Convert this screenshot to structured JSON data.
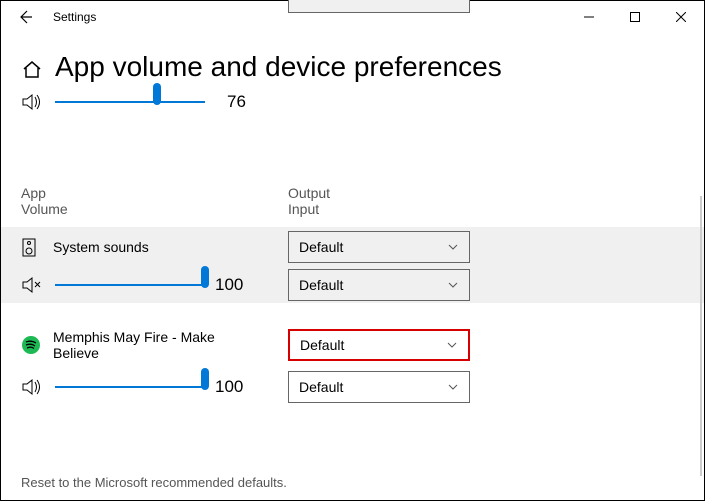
{
  "title": "Settings",
  "heading": "App volume and device preferences",
  "master_volume": 76,
  "master_thumb": 68,
  "cols": {
    "c1a": "App",
    "c1b": "Volume",
    "c2a": "Output",
    "c2b": "Input"
  },
  "apps": [
    {
      "name": "System sounds",
      "vol": 100,
      "out": "Default",
      "in": "Default",
      "muted": true
    },
    {
      "name": "Memphis May Fire - Make Believe",
      "vol": 100,
      "out": "Default",
      "in": "Default",
      "muted": false
    }
  ],
  "reset": "Reset to the Microsoft recommended defaults."
}
